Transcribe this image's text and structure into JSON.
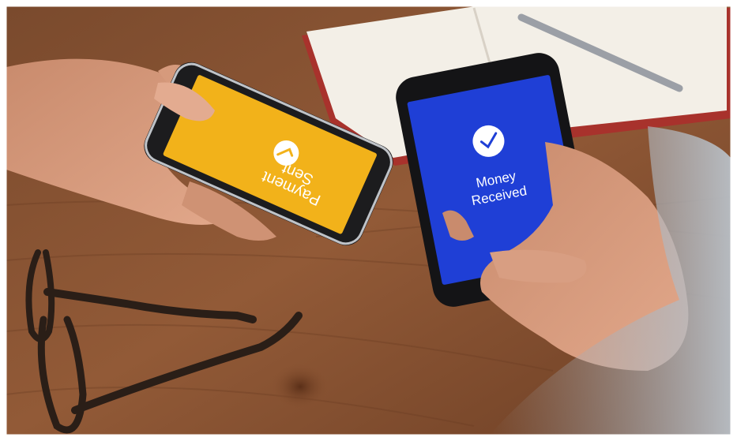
{
  "left_phone": {
    "screen_color": "#f2b21a",
    "line1": "Payment",
    "line2": "Sent",
    "icon": "check-icon"
  },
  "right_phone": {
    "screen_color": "#1f3fd6",
    "line1": "Money",
    "line2": "Received",
    "icon": "check-icon"
  },
  "colors": {
    "table": "#8a5331",
    "table_dark": "#5e3520",
    "skin": "#d79c7f",
    "notebook": "#f1ece4",
    "glasses": "#2a1e17"
  }
}
